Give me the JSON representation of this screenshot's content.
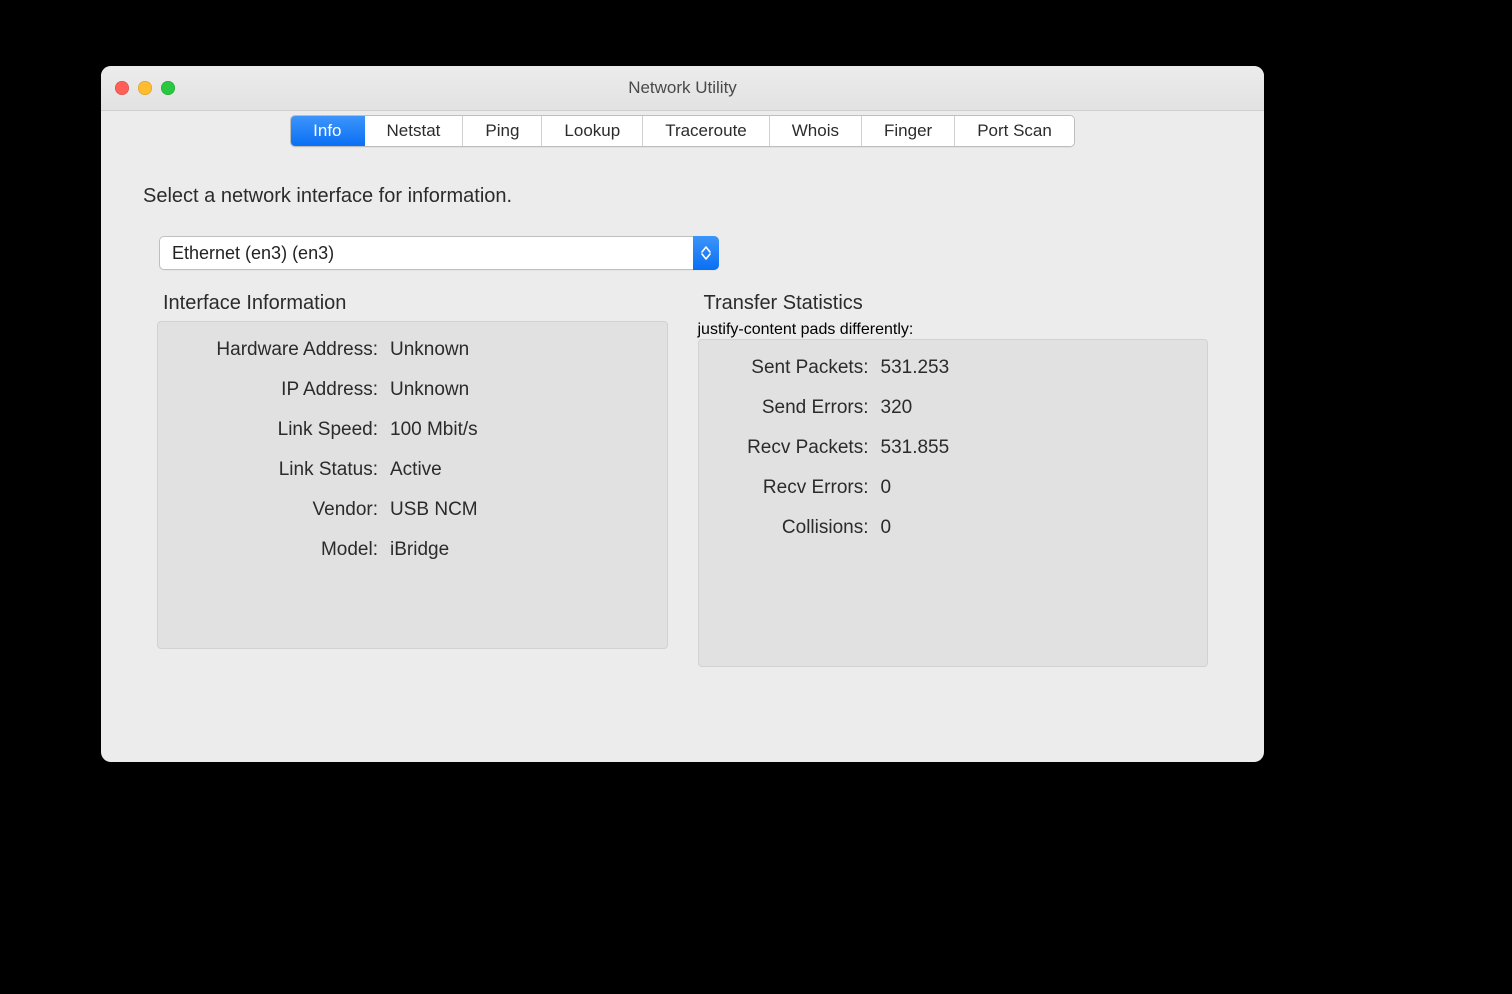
{
  "window": {
    "title": "Network Utility"
  },
  "tabs": [
    {
      "label": "Info",
      "selected": true
    },
    {
      "label": "Netstat"
    },
    {
      "label": "Ping"
    },
    {
      "label": "Lookup"
    },
    {
      "label": "Traceroute"
    },
    {
      "label": "Whois"
    },
    {
      "label": "Finger"
    },
    {
      "label": "Port Scan"
    }
  ],
  "instruction": "Select a network interface for information.",
  "interface_select": {
    "value": "Ethernet (en3) (en3)"
  },
  "panels": {
    "info": {
      "title": "Interface Information",
      "rows": [
        {
          "label": "Hardware Address:",
          "value": "Unknown"
        },
        {
          "label": "IP Address:",
          "value": "Unknown"
        },
        {
          "label": "Link Speed:",
          "value": "100 Mbit/s"
        },
        {
          "label": "Link Status:",
          "value": "Active"
        },
        {
          "label": "Vendor:",
          "value": "USB NCM"
        },
        {
          "label": "Model:",
          "value": "iBridge"
        }
      ]
    },
    "stats": {
      "title": "Transfer Statistics",
      "rows": [
        {
          "label": "Sent Packets:",
          "value": "531.253"
        },
        {
          "label": "Send Errors:",
          "value": "320"
        },
        {
          "label": "Recv Packets:",
          "value": "531.855"
        },
        {
          "label": "Recv Errors:",
          "value": "0"
        },
        {
          "label": "Collisions:",
          "value": "0"
        }
      ]
    }
  }
}
